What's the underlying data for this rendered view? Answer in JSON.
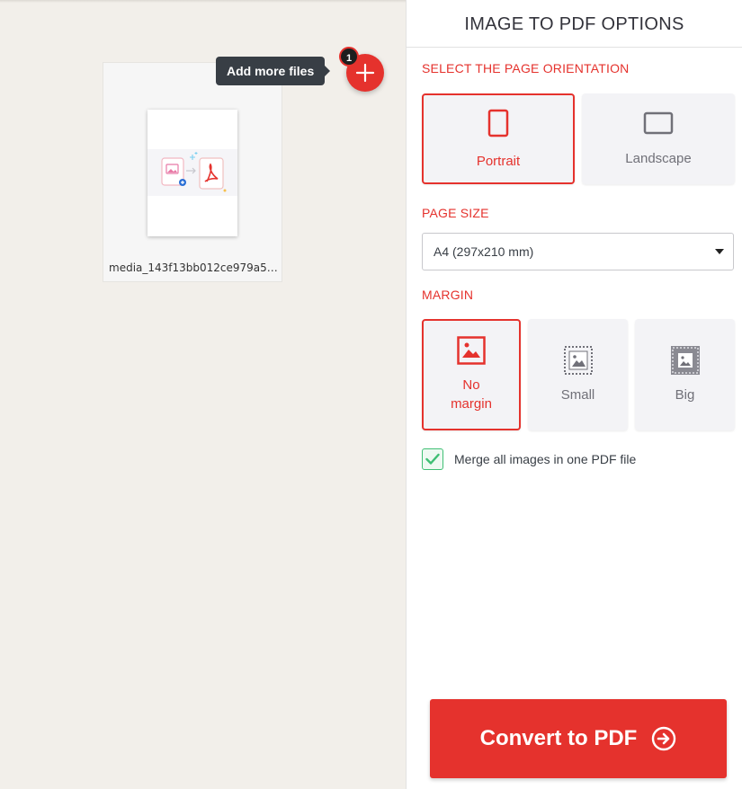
{
  "workspace": {
    "file": {
      "name": "media_143f13bb012ce979a51e..."
    },
    "tooltip": "Add more files",
    "file_count": "1"
  },
  "sidebar": {
    "title": "IMAGE TO PDF OPTIONS",
    "orientation": {
      "label": "SELECT THE PAGE ORIENTATION",
      "options": [
        {
          "label": "Portrait",
          "selected": true
        },
        {
          "label": "Landscape",
          "selected": false
        }
      ]
    },
    "page_size": {
      "label": "PAGE SIZE",
      "value": "A4 (297x210 mm)"
    },
    "margin": {
      "label": "MARGIN",
      "options": [
        {
          "label": "No margin",
          "selected": true
        },
        {
          "label": "Small",
          "selected": false
        },
        {
          "label": "Big",
          "selected": false
        }
      ]
    },
    "merge": {
      "label": "Merge all images in one PDF file",
      "checked": true
    },
    "convert_button": "Convert to PDF"
  },
  "colors": {
    "accent": "#e5322d",
    "check": "#3fbf74",
    "workspace_bg": "#f2efea",
    "option_bg": "#f3f3f6"
  }
}
